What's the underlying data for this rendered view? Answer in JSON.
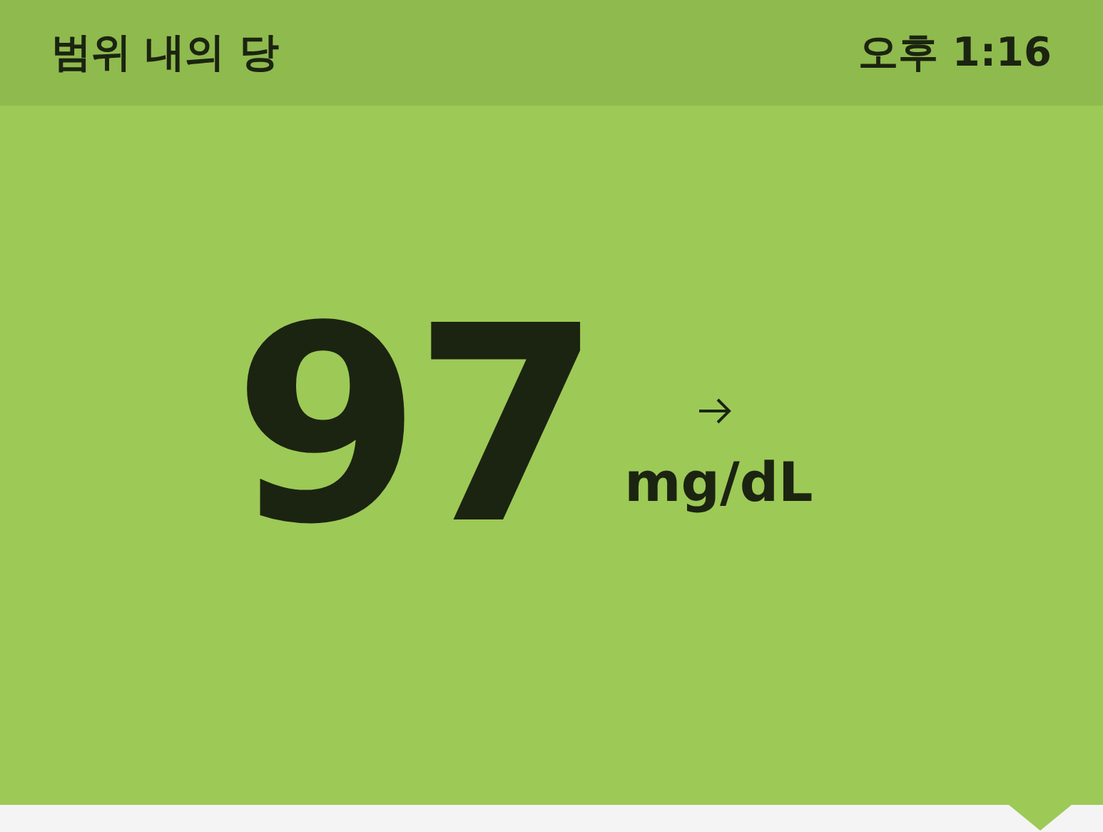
{
  "header": {
    "title": "범위 내의 당",
    "time": "오후 1:16"
  },
  "reading": {
    "value": "97",
    "unit": "mg/dL"
  }
}
